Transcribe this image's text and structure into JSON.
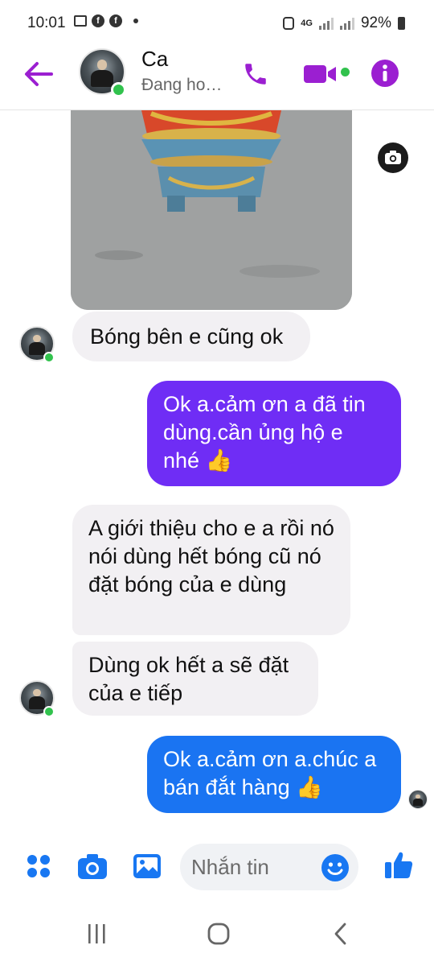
{
  "status_bar": {
    "time": "10:01",
    "network": "4G",
    "battery": "92%",
    "f_glyph": "f"
  },
  "header": {
    "name": "Ca",
    "status": "Đang ho…",
    "accent": "#9b1fd1"
  },
  "messages": [
    {
      "id": "m1",
      "side": "received",
      "text": "Bóng bên e cũng ok"
    },
    {
      "id": "m2",
      "side": "sent",
      "text": "Ok a.cảm ơn a đã tin dùng.cần ủng hộ e nhé 👍",
      "color": "#6f2df5"
    },
    {
      "id": "m3",
      "side": "received",
      "text": "A giới thiệu cho e a rồi nó nói dùng hết bóng cũ nó đặt bóng của e dùng"
    },
    {
      "id": "m4",
      "side": "received",
      "text": "Dùng ok hết a sẽ đặt của e tiếp"
    },
    {
      "id": "m5",
      "side": "sent",
      "text": "Ok a.cảm ơn a.chúc a bán đắt hàng 👍",
      "color": "#1a74f2"
    }
  ],
  "composer": {
    "placeholder": "Nhắn tin",
    "accent": "#1877f2"
  },
  "icons": [
    "back-arrow-icon",
    "phone-icon",
    "video-icon",
    "info-icon",
    "camera-icon",
    "apps-icon",
    "gallery-icon",
    "emoji-icon",
    "like-icon"
  ]
}
